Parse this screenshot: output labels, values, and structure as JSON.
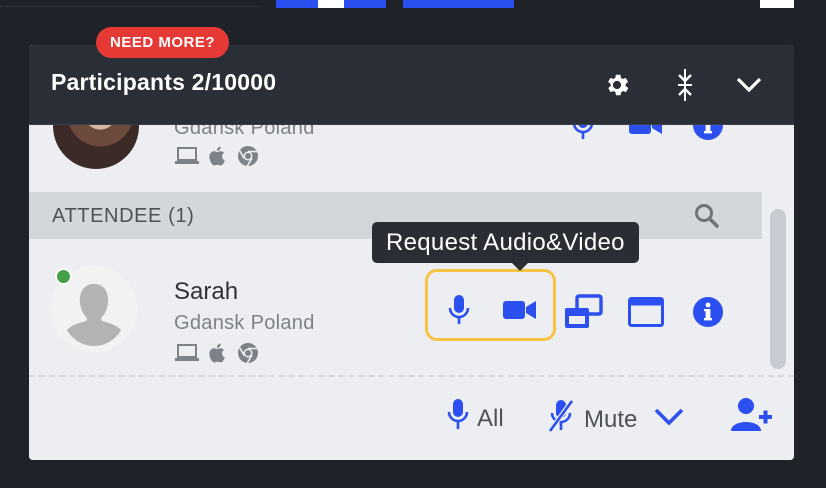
{
  "panel": {
    "title": "Participants 2/10000",
    "badge": "NEED MORE?"
  },
  "participants_top": {
    "location": "Gdansk Poland"
  },
  "section": {
    "label": "ATTENDEE",
    "count": "(1)"
  },
  "attendee": {
    "name": "Sarah",
    "location": "Gdansk Poland",
    "status_color": "#43a047"
  },
  "tooltip": {
    "text": "Request Audio&Video"
  },
  "footer": {
    "all_label": "All",
    "mute_label": "Mute"
  },
  "colors": {
    "accent": "#2c4ff0",
    "highlight": "#f6c343",
    "badge": "#e53935",
    "header": "#2a2e36"
  },
  "icons": [
    "gear-icon",
    "collapse-icon",
    "chevron-down-icon",
    "laptop-icon",
    "apple-icon",
    "chrome-icon",
    "search-icon",
    "microphone-icon",
    "video-camera-icon",
    "screen-share-icon",
    "window-icon",
    "info-icon",
    "microphone-off-icon",
    "add-user-icon"
  ]
}
